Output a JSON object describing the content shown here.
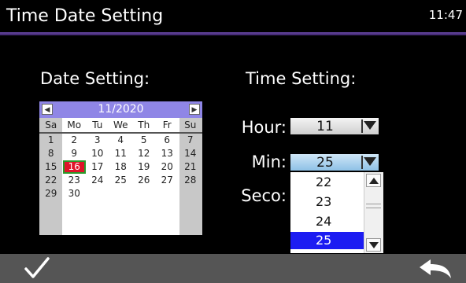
{
  "title": "Time Date Setting",
  "clock": "11:47",
  "date_section": {
    "label": "Date Setting:"
  },
  "time_section": {
    "label": "Time Setting:"
  },
  "calendar": {
    "month_label": "11/2020",
    "weekdays": [
      "Sa",
      "Mo",
      "Tu",
      "We",
      "Th",
      "Fr",
      "Su"
    ],
    "weeks": [
      [
        "1",
        "2",
        "3",
        "4",
        "5",
        "6",
        "7"
      ],
      [
        "8",
        "9",
        "10",
        "11",
        "12",
        "13",
        "14"
      ],
      [
        "15",
        "16",
        "17",
        "18",
        "19",
        "20",
        "21"
      ],
      [
        "22",
        "23",
        "24",
        "25",
        "26",
        "27",
        "28"
      ],
      [
        "29",
        "30",
        "",
        "",
        "",
        "",
        ""
      ]
    ],
    "selected_day": "16"
  },
  "hour": {
    "label": "Hour:",
    "value": "11"
  },
  "minute": {
    "label": "Min:",
    "value": "25",
    "options": [
      "22",
      "23",
      "24",
      "25"
    ],
    "selected": "25"
  },
  "second": {
    "label": "Seco:"
  },
  "colors": {
    "title_rule": "#5a3a99",
    "calendar_header": "#8f86e6",
    "selected_option": "#1c1cf2",
    "today_bg": "#e0142a"
  },
  "icons": {
    "confirm": "checkmark-icon",
    "back": "return-arrow-icon"
  }
}
